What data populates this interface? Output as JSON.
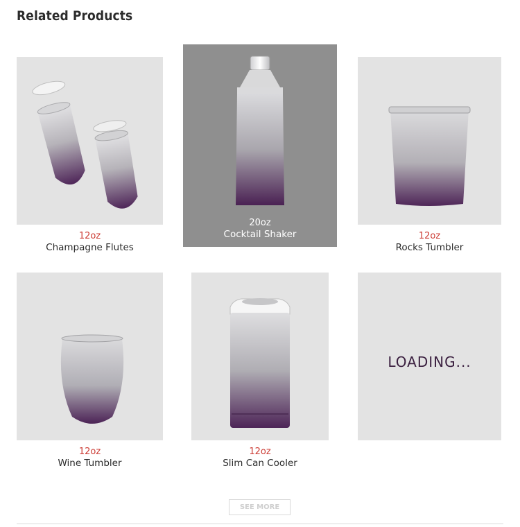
{
  "section": {
    "title": "Related Products"
  },
  "products": [
    {
      "size": "12oz",
      "name": "Champagne Flutes"
    },
    {
      "size": "20oz",
      "name": "Cocktail Shaker"
    },
    {
      "size": "12oz",
      "name": "Rocks Tumbler"
    },
    {
      "size": "12oz",
      "name": "Wine Tumbler"
    },
    {
      "size": "12oz",
      "name": "Slim Can Cooler"
    }
  ],
  "loading_tile": {
    "text": "LOADING..."
  },
  "see_more": {
    "label": "SEE MORE"
  },
  "colors": {
    "tile_bg": "#e3e3e3",
    "tile_hover_bg": "#8f8f8f",
    "size_red": "#cc3b33",
    "purple_accent": "#4b2456",
    "silver": "#c8c8cc"
  }
}
